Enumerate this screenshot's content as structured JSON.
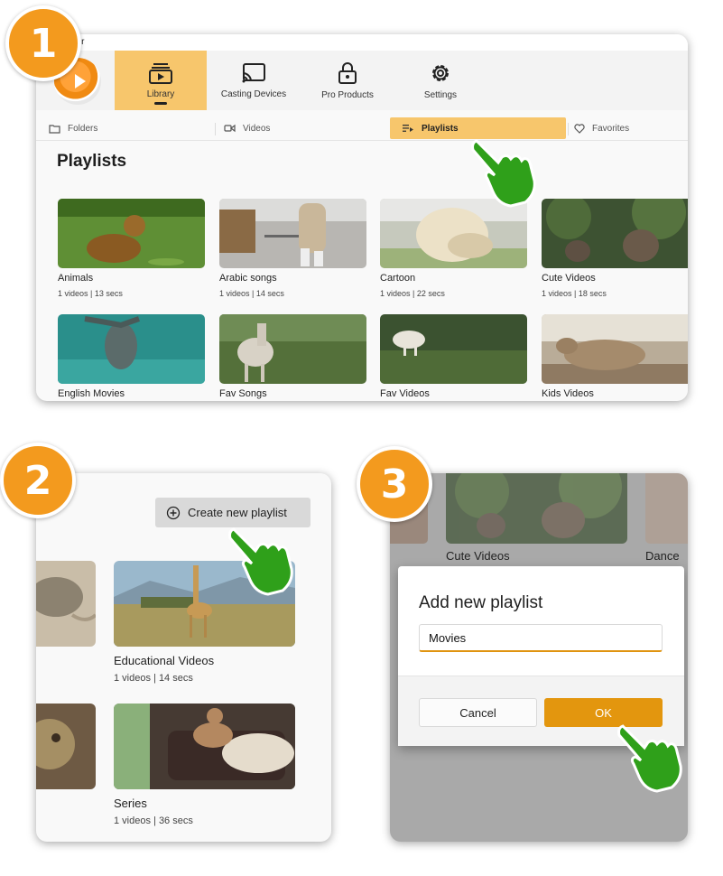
{
  "steps": [
    "1",
    "2",
    "3"
  ],
  "app": {
    "title_fragment": "ayer"
  },
  "nav": [
    {
      "label": "Library",
      "icon": "library-icon",
      "active": true
    },
    {
      "label": "Casting Devices",
      "icon": "cast-icon"
    },
    {
      "label": "Pro Products",
      "icon": "lock-icon"
    },
    {
      "label": "Settings",
      "icon": "gear-icon"
    }
  ],
  "tabs": [
    {
      "label": "Folders",
      "icon": "folder-icon"
    },
    {
      "label": "Videos",
      "icon": "video-camera-icon"
    },
    {
      "label": "Playlists",
      "icon": "playlist-icon",
      "active": true
    },
    {
      "label": "Favorites",
      "icon": "heart-icon"
    }
  ],
  "page_title": "Playlists",
  "playlists": [
    {
      "title": "Animals",
      "meta": "1 videos | 13 secs"
    },
    {
      "title": "Arabic songs",
      "meta": "1 videos | 14 secs"
    },
    {
      "title": "Cartoon",
      "meta": "1 videos | 22 secs"
    },
    {
      "title": "Cute Videos",
      "meta": "1 videos | 18 secs"
    },
    {
      "title": "English Movies",
      "meta": ""
    },
    {
      "title": "Fav Songs",
      "meta": ""
    },
    {
      "title": "Fav Videos",
      "meta": ""
    },
    {
      "title": "Kids Videos",
      "meta": ""
    }
  ],
  "panel2": {
    "create_button": "Create new playlist",
    "cards": [
      {
        "title": "Educational Videos",
        "meta": "1 videos | 14 secs"
      },
      {
        "title": "Series",
        "meta": "1 videos | 36 secs"
      }
    ]
  },
  "panel3": {
    "background_cards": [
      "Cute Videos",
      "Dance"
    ],
    "dialog": {
      "title": "Add new playlist",
      "input_value": "Movies",
      "cancel": "Cancel",
      "ok": "OK"
    }
  },
  "colors": {
    "accent": "#f7c66c",
    "badge": "#f39a1e",
    "ok_button": "#e3960e",
    "hand": "#2fa01a"
  }
}
